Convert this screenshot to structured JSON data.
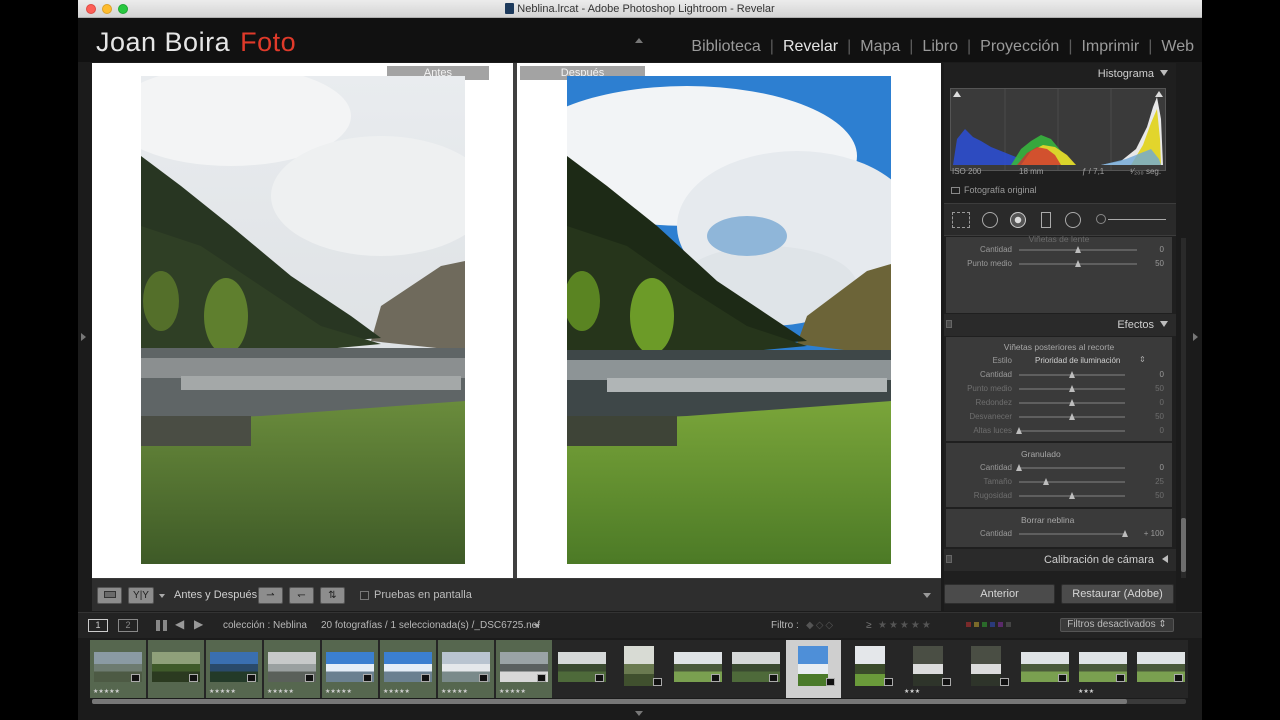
{
  "window": {
    "title": "Neblina.lrcat - Adobe Photoshop Lightroom - Revelar"
  },
  "identity_plate": {
    "name": "Joan Boira",
    "accent_word": "Foto",
    "accent_color": "#e03a2a"
  },
  "modules": {
    "items": [
      {
        "label": "Biblioteca",
        "active": false
      },
      {
        "label": "Revelar",
        "active": true
      },
      {
        "label": "Mapa",
        "active": false
      },
      {
        "label": "Libro",
        "active": false
      },
      {
        "label": "Proyección",
        "active": false
      },
      {
        "label": "Imprimir",
        "active": false
      },
      {
        "label": "Web",
        "active": false
      }
    ],
    "separator": "|"
  },
  "compare": {
    "before_label": "Antes",
    "after_label": "Después"
  },
  "toolbar": {
    "view_yy": "Y|Y",
    "before_after_label": "Antes y Después:",
    "soft_proof_label": "Pruebas en pantalla"
  },
  "histogram": {
    "title": "Histograma",
    "iso": "ISO 200",
    "focal": "18 mm",
    "aperture": "ƒ / 7,1",
    "shutter": "¹⁄₂₀₀ seg.",
    "original_photo": "Fotografía original"
  },
  "vignette_lens": {
    "title": "Viñetas de lente",
    "rows": [
      {
        "label": "Cantidad",
        "value": "0",
        "position": 0.5
      },
      {
        "label": "Punto medio",
        "value": "50",
        "position": 0.5
      }
    ]
  },
  "effects": {
    "title": "Efectos",
    "postcrop_title": "Viñetas posteriores al recorte",
    "style_label": "Estilo",
    "style_value": "Prioridad de iluminación",
    "postcrop_rows": [
      {
        "label": "Cantidad",
        "value": "0",
        "position": 0.5,
        "dim": false
      },
      {
        "label": "Punto medio",
        "value": "50",
        "position": 0.5,
        "dim": true
      },
      {
        "label": "Redondez",
        "value": "0",
        "position": 0.5,
        "dim": true
      },
      {
        "label": "Desvanecer",
        "value": "50",
        "position": 0.5,
        "dim": true
      },
      {
        "label": "Altas luces",
        "value": "0",
        "position": 0.0,
        "dim": true
      }
    ],
    "grain_title": "Granulado",
    "grain_rows": [
      {
        "label": "Cantidad",
        "value": "0",
        "position": 0.0,
        "dim": false
      },
      {
        "label": "Tamaño",
        "value": "25",
        "position": 0.25,
        "dim": true
      },
      {
        "label": "Rugosidad",
        "value": "50",
        "position": 0.5,
        "dim": true
      }
    ],
    "dehaze_title": "Borrar neblina",
    "dehaze_rows": [
      {
        "label": "Cantidad",
        "value": "+ 100",
        "position": 1.0,
        "dim": false
      }
    ]
  },
  "calibration": {
    "title": "Calibración de cámara"
  },
  "panel_buttons": {
    "previous": "Anterior",
    "reset": "Restaurar (Adobe)"
  },
  "filmstrip_bar": {
    "monitor1": "1",
    "monitor2": "2",
    "collection": "colección : Neblina",
    "count": "20 fotografías / 1 seleccionada(s) /_DSC6725.nef",
    "filter_label": "Filtro :",
    "filters_state": "Filtros desactivados"
  },
  "filmstrip": {
    "thumbs": [
      {
        "rating": "★★★★★",
        "bg": "green",
        "tone": "lake-gray"
      },
      {
        "rating": "",
        "bg": "green",
        "tone": "forest"
      },
      {
        "rating": "★★★★★",
        "bg": "green",
        "tone": "blue-lake"
      },
      {
        "rating": "★★★★★",
        "bg": "green",
        "tone": "fog"
      },
      {
        "rating": "★★★★★",
        "bg": "green",
        "tone": "blue-sky"
      },
      {
        "rating": "★★★★★",
        "bg": "green",
        "tone": "blue-sky"
      },
      {
        "rating": "★★★★★",
        "bg": "green",
        "tone": "cloud"
      },
      {
        "rating": "★★★★★",
        "bg": "green",
        "tone": "road"
      },
      {
        "rating": "",
        "bg": "dark",
        "tone": "lake-dark"
      },
      {
        "rating": "",
        "bg": "dark",
        "tone": "tree-portrait"
      },
      {
        "rating": "",
        "bg": "dark",
        "tone": "valley"
      },
      {
        "rating": "",
        "bg": "dark",
        "tone": "lake-dark"
      },
      {
        "rating": "",
        "bg": "sel",
        "tone": "current"
      },
      {
        "rating": "",
        "bg": "dark",
        "tone": "current-dim"
      },
      {
        "rating": "★★★",
        "bg": "dark",
        "tone": "waterfall"
      },
      {
        "rating": "",
        "bg": "dark",
        "tone": "waterfall"
      },
      {
        "rating": "",
        "bg": "dark",
        "tone": "valley"
      },
      {
        "rating": "★★★",
        "bg": "dark",
        "tone": "valley"
      },
      {
        "rating": "",
        "bg": "dark",
        "tone": "valley"
      }
    ]
  }
}
